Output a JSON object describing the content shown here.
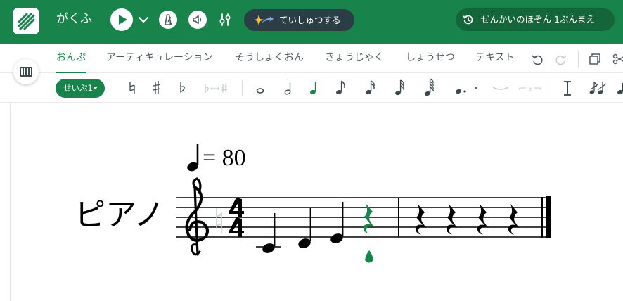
{
  "header": {
    "title": "がくふ",
    "submit_label": "ていしゅつする",
    "history_label": "ぜんかいのほぞん 1ぷんまえ"
  },
  "tabs": [
    {
      "label": "おんぷ",
      "active": true
    },
    {
      "label": "アーティキュレーション",
      "active": false
    },
    {
      "label": "そうしょくおん",
      "active": false
    },
    {
      "label": "きょうじゃく",
      "active": false
    },
    {
      "label": "しょうせつ",
      "active": false
    },
    {
      "label": "テキスト",
      "active": false
    }
  ],
  "toolbar": {
    "voice_label": "せいぶ1",
    "tool_icons": [
      "natural-icon",
      "sharp-icon",
      "flat-icon",
      "enharmonic-icon",
      "whole-note-icon",
      "half-note-icon",
      "quarter-note-icon",
      "eighth-note-icon",
      "sixteenth-note-icon",
      "thirty-second-note-icon",
      "sixty-fourth-note-icon",
      "dotted-note-icon",
      "tie-icon",
      "tuplet-icon",
      "stem-icon",
      "grace-note-icon",
      "more-icon"
    ],
    "selected_duration": "quarter-note-icon"
  },
  "score": {
    "tempo_value": "= 80",
    "instrument": "ピアノ",
    "time_signature": "4/4",
    "clef": "treble",
    "measures": [
      [
        "C4 quarter",
        "D4 quarter",
        "E4 quarter",
        "quarter rest (selected)"
      ],
      [
        "quarter rest",
        "quarter rest",
        "quarter rest",
        "quarter rest"
      ]
    ]
  },
  "colors": {
    "brand": "#18834a",
    "brand_dark": "#14663a",
    "pill_dark": "#2c3e45",
    "selection": "#18834a"
  }
}
